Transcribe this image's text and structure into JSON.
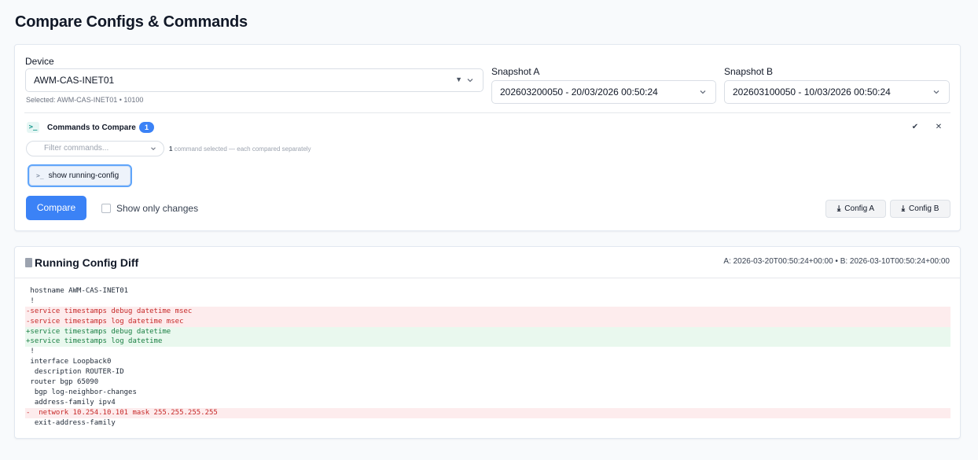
{
  "page": {
    "title": "Compare Configs & Commands"
  },
  "device": {
    "label": "Device",
    "value": "AWM-CAS-INET01",
    "hint": "Selected: AWM-CAS-INET01 • 10100"
  },
  "snapshot_a": {
    "label": "Snapshot A",
    "value": "202603200050 - 20/03/2026 00:50:24"
  },
  "snapshot_b": {
    "label": "Snapshot B",
    "value": "202603100050 - 10/03/2026 00:50:24"
  },
  "commands": {
    "title": "Commands to Compare",
    "count": "1",
    "filter_placeholder": "Filter commands...",
    "selected_count": "1",
    "selected_text": " command selected — each compared separately",
    "chips": [
      {
        "label": "show running-config"
      }
    ]
  },
  "actions": {
    "compare_label": "Compare",
    "show_only_changes_label": "Show only changes",
    "show_only_changes_checked": false,
    "config_a_label": "Config A",
    "config_b_label": "Config B"
  },
  "diff": {
    "title": "Running Config Diff",
    "meta": "A: 2026-03-20T00:50:24+00:00 • B: 2026-03-10T00:50:24+00:00",
    "lines": [
      {
        "type": "ctx",
        "text": " hostname AWM-CAS-INET01"
      },
      {
        "type": "ctx",
        "text": " !"
      },
      {
        "type": "del",
        "text": "-service timestamps debug datetime msec"
      },
      {
        "type": "del",
        "text": "-service timestamps log datetime msec"
      },
      {
        "type": "add",
        "text": "+service timestamps debug datetime"
      },
      {
        "type": "add",
        "text": "+service timestamps log datetime"
      },
      {
        "type": "ctx",
        "text": " !"
      },
      {
        "type": "ctx",
        "text": " interface Loopback0"
      },
      {
        "type": "ctx",
        "text": "  description ROUTER-ID"
      },
      {
        "type": "ctx",
        "text": " router bgp 65090"
      },
      {
        "type": "ctx",
        "text": "  bgp log-neighbor-changes"
      },
      {
        "type": "ctx",
        "text": "  address-family ipv4"
      },
      {
        "type": "del",
        "text": "-  network 10.254.10.101 mask 255.255.255.255"
      },
      {
        "type": "ctx",
        "text": "  exit-address-family"
      }
    ]
  },
  "colors": {
    "accent": "#3b82f6",
    "removed": "#c62828",
    "added": "#1a7f43"
  },
  "icons": [
    "chevron-down-icon",
    "terminal-icon",
    "check-icon",
    "close-icon",
    "download-icon",
    "file-icon"
  ]
}
